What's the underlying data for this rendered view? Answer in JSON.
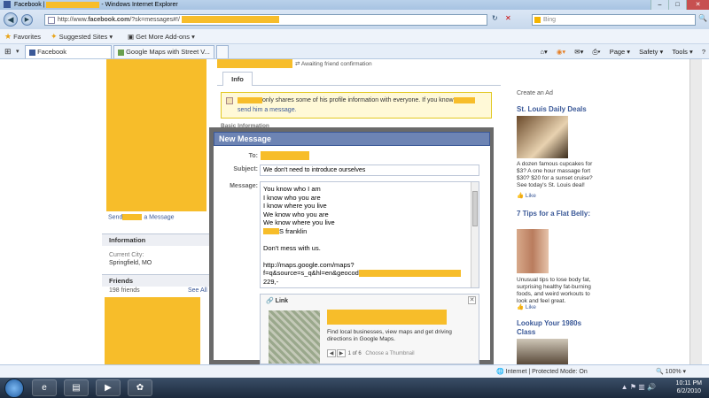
{
  "window": {
    "title": "Facebook | ",
    "title_app": "Windows Internet Explorer",
    "minimize": "–",
    "maximize": "□",
    "close": "✕"
  },
  "address": {
    "url_prefix": "http://www.",
    "url_bold": "facebook.com",
    "url_rest": "/?sk=messages#!/",
    "back_icon": "back-arrow-icon",
    "refresh": "↻",
    "stop": "✕",
    "search_placeholder": "Bing",
    "search_go": "🔍"
  },
  "favorites": {
    "label": "Favorites",
    "suggested": "Suggested Sites ▾",
    "addons": "Get More Add-ons ▾"
  },
  "tabs": [
    {
      "label": "Facebook "
    },
    {
      "label": "Google Maps with Street V..."
    }
  ],
  "commands": {
    "page": "Page ▾",
    "safety": "Safety ▾",
    "tools": "Tools ▾",
    "help": "?"
  },
  "profile": {
    "send_prefix": "Send",
    "send_suffix": "a Message",
    "information_header": "Information",
    "current_city_label": "Current City:",
    "current_city_value": "Springfield, MO",
    "friends_header": "Friends",
    "friends_count": "198 friends",
    "see_all": "See All"
  },
  "main": {
    "awaiting": "Awaiting friend confirmation",
    "info_tab": "Info",
    "privacy_text_1": "only shares some of his profile information with everyone. If you know",
    "privacy_link": "send him a message.",
    "basic_info": "Basic Information"
  },
  "ads": {
    "create_ad": "Create an Ad",
    "items": [
      {
        "title": "St. Louis Daily Deals",
        "text": "A dozen famous cupcakes for $3? A one hour massage fort $30? $20 for a sunset cruise? See today's St. Louis deal!",
        "like": "Like"
      },
      {
        "title": "7 Tips for a Flat Belly:",
        "text": "Unusual tips to lose body fat, surprising healthy fat-burning foods, and weird workouts to look and feel great.",
        "like": "Like"
      },
      {
        "title": "Lookup Your 1980s Class",
        "text": "",
        "like": ""
      }
    ]
  },
  "dialog": {
    "title": "New Message",
    "to_label": "To:",
    "subject_label": "Subject:",
    "subject_value": "We don't need to introduce ourselves",
    "message_label": "Message:",
    "message_lines": [
      "You know who I am",
      "I know who you are",
      "I know where you live",
      "We know who you are",
      "We know where you live",
      "S franklin",
      "",
      "Don't mess with us.",
      "",
      "http://maps.google.com/maps?",
      "f=q&source=s_q&hl=en&geocod",
      "229,-"
    ],
    "link_label": "Link",
    "link_close": "✕",
    "link_desc": "Find local businesses, view maps and get driving directions in Google Maps.",
    "thumb_count": "1 of 6",
    "choose_thumb": "Choose a Thumbnail"
  },
  "status": {
    "zone": "Internet | Protected Mode: On",
    "zoom": "100%"
  },
  "taskbar": {
    "time": "10:11 PM",
    "date": "6/2/2010"
  }
}
